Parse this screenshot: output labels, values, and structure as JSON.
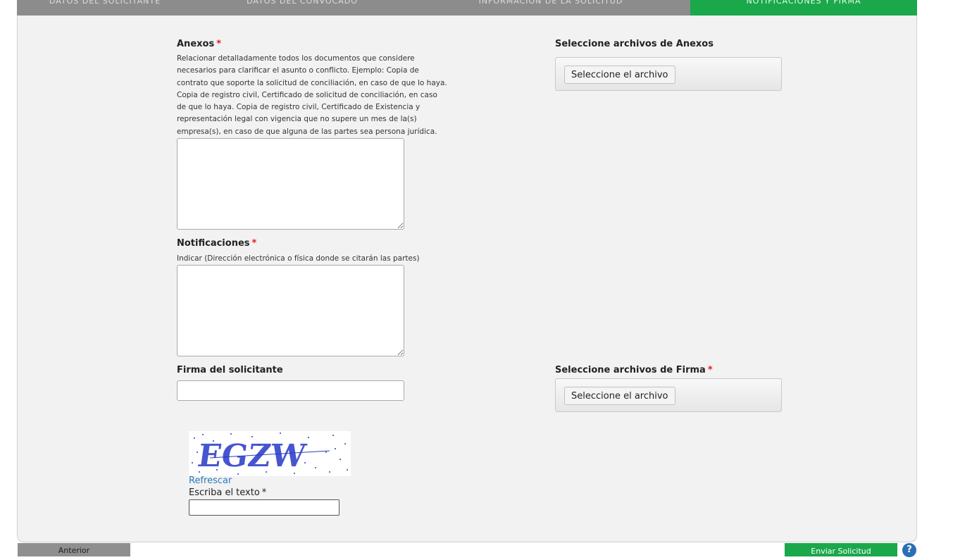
{
  "tabs": [
    "Datos del solicitante",
    "Datos del convocado",
    "Información de la solicitud",
    "Notificaciones y firma"
  ],
  "anexos": {
    "label": "Anexos",
    "required_mark": "*",
    "help_lines": [
      "Relacionar detalladamente todos los documentos que considere",
      "necesarios para clarificar el asunto o conflicto. Ejemplo: Copia de",
      "contrato que soporte la solicitud de conciliación, en caso de que lo haya.",
      "Copia de registro civil, Certificado de solicitud de conciliación, en caso",
      "de que lo haya. Copia de registro civil, Certificado de Existencia y",
      "representación legal con vigencia que no supere un mes de la(s)",
      "empresa(s), en caso de que alguna de las partes sea persona jurídica."
    ],
    "value": ""
  },
  "anexos_files": {
    "label": "Seleccione archivos de Anexos",
    "button": "Seleccione el archivo"
  },
  "notificaciones": {
    "label": "Notificaciones",
    "required_mark": "*",
    "help": "Indicar (Dirección electrónica o física donde se citarán las partes)",
    "value": ""
  },
  "firma": {
    "label": "Firma del solicitante",
    "value": ""
  },
  "firma_files": {
    "label": "Seleccione archivos de Firma",
    "required_mark": "*",
    "button": "Seleccione el archivo"
  },
  "captcha": {
    "image_text": "EGZW",
    "refresh": "Refrescar",
    "label": "Escriba el texto",
    "required_mark": "*",
    "value": ""
  },
  "footer": {
    "prev": "Anterior",
    "send": "Enviar Solicitud",
    "help_icon": "?"
  },
  "colors": {
    "accent_green": "#1aa84b",
    "tab_gray": "#8c8c8c",
    "link_blue": "#2a7ab8",
    "required_red": "#e02020"
  }
}
